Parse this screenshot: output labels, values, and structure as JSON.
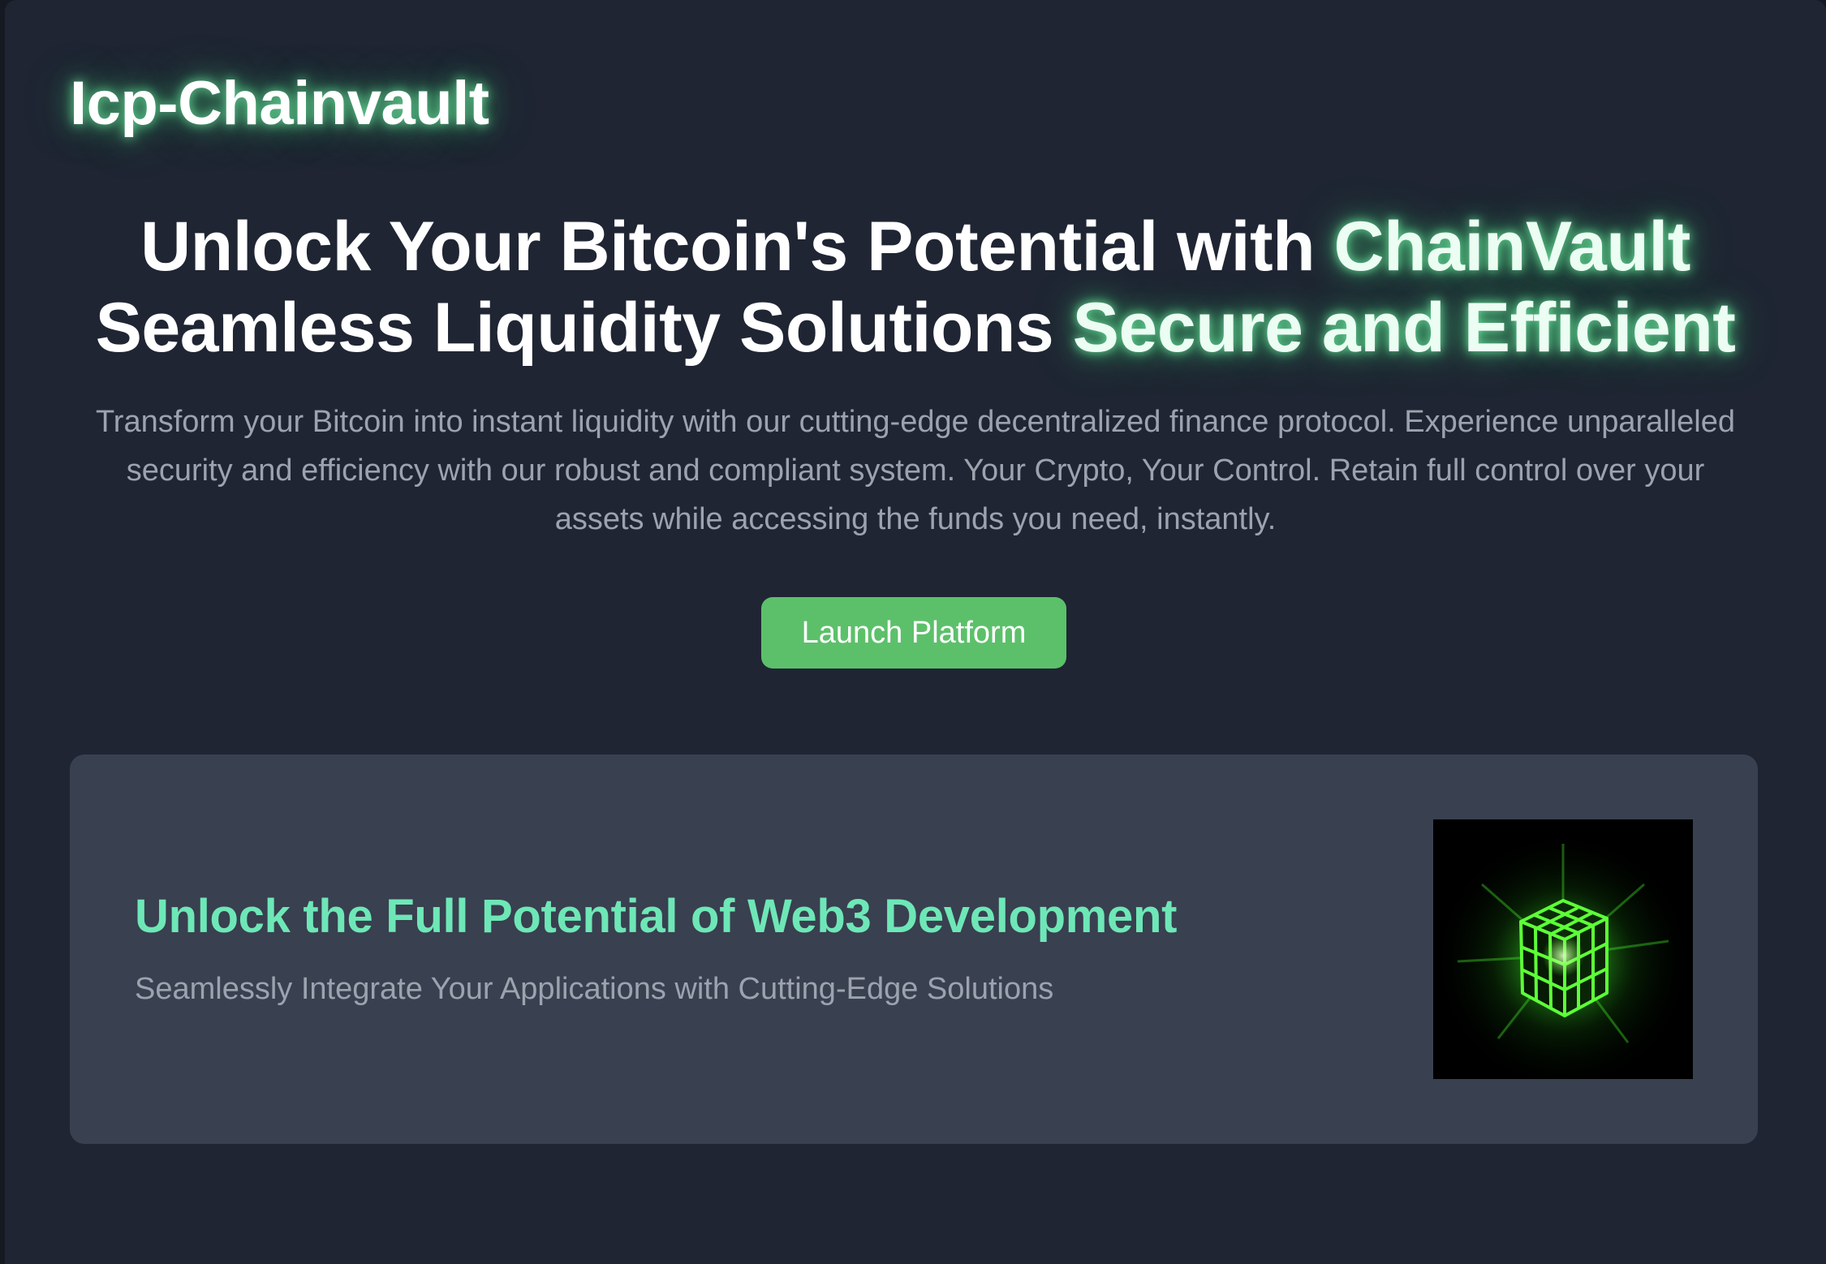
{
  "brand": {
    "name": "Icp-Chainvault"
  },
  "hero": {
    "title_line1_plain": "Unlock Your Bitcoin's Potential with ",
    "title_line1_glow": "ChainVault",
    "title_line2_plain": "Seamless Liquidity Solutions ",
    "title_line2_glow": "Secure and Efficient",
    "description": "Transform your Bitcoin into instant liquidity with our cutting-edge decentralized finance protocol. Experience unparalleled security and efficiency with our robust and compliant system. Your Crypto, Your Control. Retain full control over your assets while accessing the funds you need, instantly.",
    "cta_label": "Launch Platform"
  },
  "feature_card": {
    "title": "Unlock the Full Potential of Web3 Development",
    "subtitle": "Seamlessly Integrate Your Applications with Cutting-Edge Solutions",
    "image_icon": "glowing-cube-icon"
  },
  "colors": {
    "page_bg": "#1f2533",
    "card_bg": "#394050",
    "accent_green": "#5cc06a",
    "card_title": "#6ee7b7",
    "muted_text": "#9ca3af",
    "glow": "#4ade80"
  }
}
